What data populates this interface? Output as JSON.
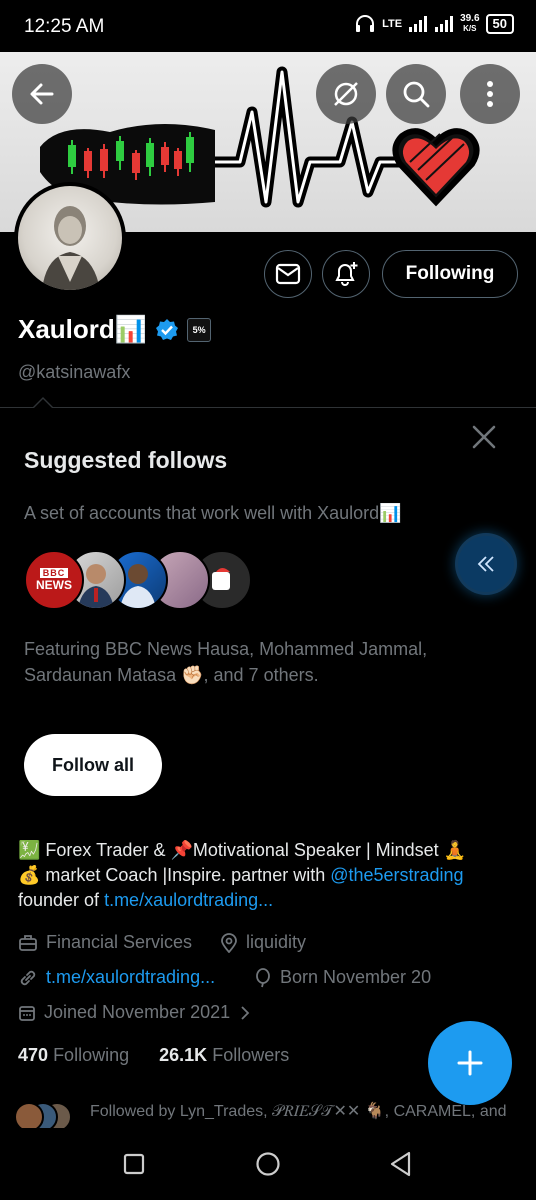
{
  "status_bar": {
    "time": "12:25 AM",
    "network": "LTE",
    "speed_value": "39.6",
    "speed_unit": "K/S",
    "battery": "50"
  },
  "header": {
    "back_icon": "arrow-left-icon",
    "grok_icon": "grok-icon",
    "search_icon": "search-icon",
    "more_icon": "more-vertical-icon"
  },
  "profile": {
    "display_name": "Xaulord📊",
    "handle": "@katsinawafx",
    "verified": true,
    "affiliate_badge": "5%",
    "following_button": "Following"
  },
  "suggested": {
    "title": "Suggested follows",
    "subtitle": "A set of accounts that work well with Xaulord📊",
    "avatar_badge_top": "BBC",
    "avatar_badge_bottom": "NEWS",
    "featuring": "Featuring BBC News Hausa, Mohammed Jammal, Sardaunan Matasa ✊🏻, and 7 others.",
    "follow_all": "Follow all"
  },
  "bio": {
    "line1_a": "💹 Forex Trader & 📌Motivational Speaker | Mindset 🧘",
    "line2_a": "💰 market Coach |Inspire. partner with ",
    "line2_link": "@the5erstrading",
    "line3_a": "founder of ",
    "line3_link": "t.me/xaulordtrading..."
  },
  "meta": {
    "category": "Financial Services",
    "location": "liquidity",
    "website": "t.me/xaulordtrading...",
    "born": "Born November 20",
    "joined": "Joined November 2021"
  },
  "counts": {
    "following_count": "470",
    "following_label": "Following",
    "followers_count": "26.1K",
    "followers_label": "Followers"
  },
  "followed_by": {
    "text": "Followed by Lyn_Trades, 𝒫𝑅𝐼𝐸𝒮𝒯✕✕ 🐐, CARAMEL, and"
  },
  "colors": {
    "accent": "#1d9bf0",
    "background": "#000000",
    "secondary_text": "#71767b"
  }
}
